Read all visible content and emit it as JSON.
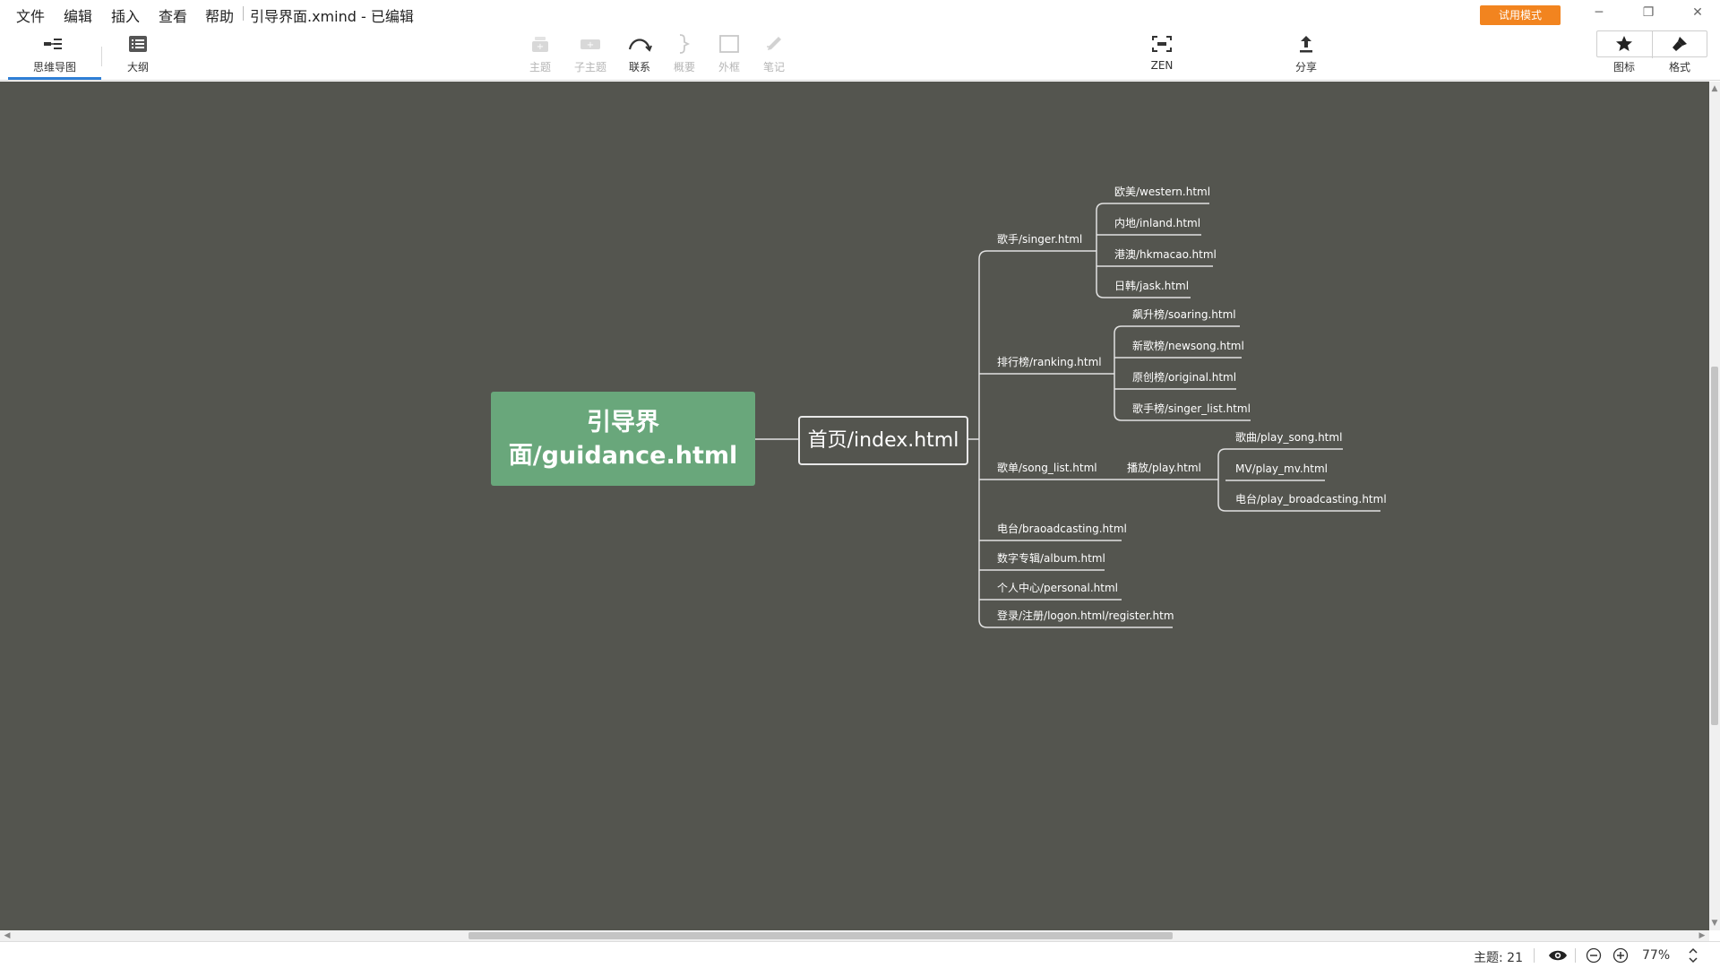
{
  "menu": [
    "文件",
    "编辑",
    "插入",
    "查看",
    "帮助"
  ],
  "document_title": "引导界面.xmind - 已编辑",
  "trial_button": "试用模式",
  "toolbar": {
    "mindmap": "思维导图",
    "outline": "大纲",
    "topic": "主题",
    "subtopic": "子主题",
    "relationship": "联系",
    "summary": "概要",
    "boundary": "外框",
    "note": "笔记",
    "zen": "ZEN",
    "share": "分享",
    "icon": "图标",
    "format": "格式"
  },
  "mindmap": {
    "root": "引导界面/guidance.html",
    "main": "首页/index.html",
    "singer": "歌手/singer.html",
    "singer_children": [
      "欧美/western.html",
      "内地/inland.html",
      "港澳/hkmacao.html",
      "日韩/jask.html"
    ],
    "ranking": "排行榜/ranking.html",
    "ranking_children": [
      "飙升榜/soaring.html",
      "新歌榜/newsong.html",
      "原创榜/original.html",
      "歌手榜/singer_list.html"
    ],
    "songlist": "歌单/song_list.html",
    "play": "播放/play.html",
    "play_children": [
      "歌曲/play_song.html",
      "MV/play_mv.html",
      "电台/play_broadcasting.html"
    ],
    "others": [
      "电台/braoadcasting.html",
      "数字专辑/album.html",
      "个人中心/personal.html",
      "登录/注册/logon.html/register.htm"
    ]
  },
  "status": {
    "topic_count": "主题: 21",
    "zoom": "77%"
  },
  "colors": {
    "canvas": "#54554f",
    "root_fill": "#69a77b",
    "trial": "#f2841f",
    "line": "#e2e2e2",
    "accent": "#2f7fd6"
  }
}
